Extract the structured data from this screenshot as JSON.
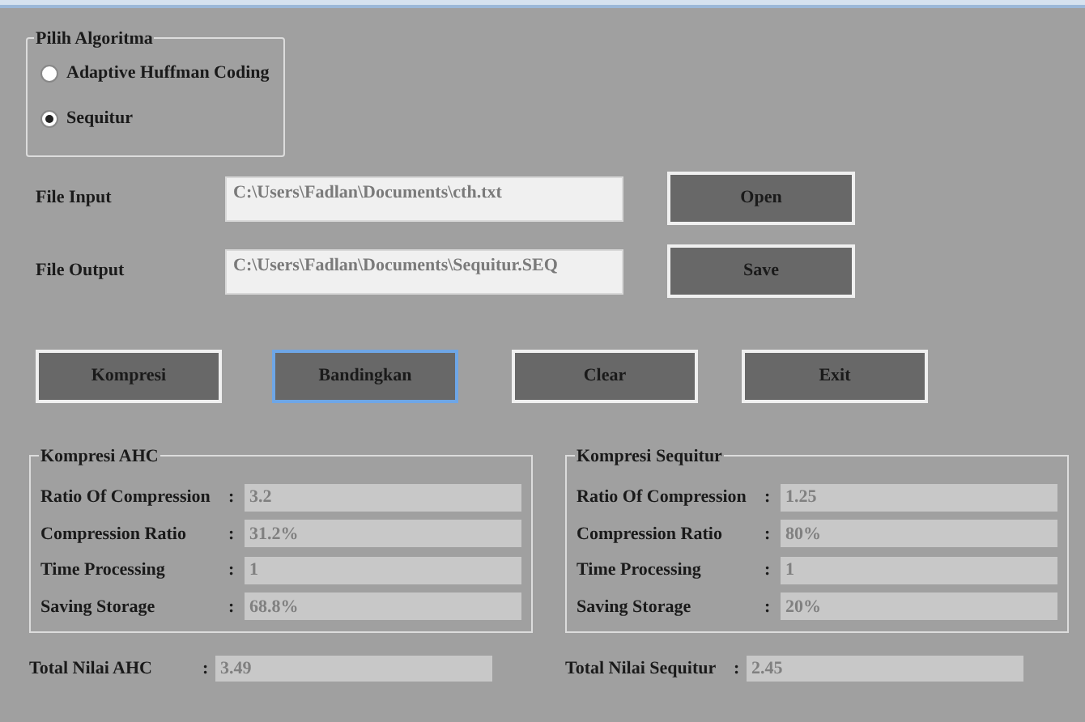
{
  "algorithm_group": {
    "title": "Pilih Algoritma",
    "options": [
      {
        "label": "Adaptive Huffman Coding",
        "selected": false
      },
      {
        "label": "Sequitur",
        "selected": true
      }
    ]
  },
  "files": [
    {
      "label": "File Input",
      "value": "C:\\Users\\Fadlan\\Documents\\cth.txt",
      "button": "Open"
    },
    {
      "label": "File Output",
      "value": "C:\\Users\\Fadlan\\Documents\\Sequitur.SEQ",
      "button": "Save"
    }
  ],
  "actions": [
    {
      "label": "Kompresi",
      "focused": false
    },
    {
      "label": "Bandingkan",
      "focused": true
    },
    {
      "label": "Clear",
      "focused": false
    },
    {
      "label": "Exit",
      "focused": false
    }
  ],
  "results": [
    {
      "title": "Kompresi AHC",
      "rows": [
        {
          "label": "Ratio Of Compression",
          "separator": ":",
          "value": "3.2"
        },
        {
          "label": "Compression Ratio",
          "separator": ":",
          "value": "31.2%"
        },
        {
          "label": "Time Processing",
          "separator": ":",
          "value": "1"
        },
        {
          "label": "Saving Storage",
          "separator": ":",
          "value": "68.8%"
        }
      ],
      "total": {
        "label": "Total Nilai AHC",
        "separator": ":",
        "value": "3.49"
      }
    },
    {
      "title": "Kompresi Sequitur",
      "rows": [
        {
          "label": "Ratio Of Compression",
          "separator": ":",
          "value": "1.25"
        },
        {
          "label": "Compression Ratio",
          "separator": ":",
          "value": "80%"
        },
        {
          "label": "Time Processing",
          "separator": ":",
          "value": "1"
        },
        {
          "label": "Saving Storage",
          "separator": ":",
          "value": "20%"
        }
      ],
      "total": {
        "label": "Total Nilai Sequitur",
        "separator": ":",
        "value": "2.45"
      }
    }
  ]
}
